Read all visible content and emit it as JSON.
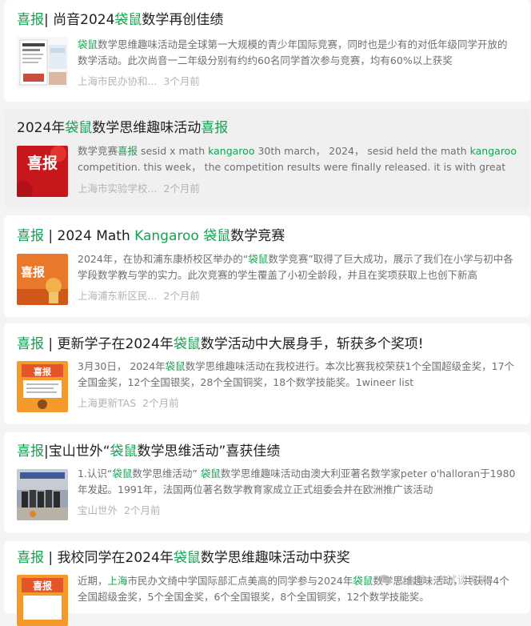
{
  "colors": {
    "keyword": "#15a150",
    "title": "#1f1f1f",
    "summary": "#6f6f6f",
    "meta": "#b3b3b3"
  },
  "articles": [
    {
      "title": [
        "喜报",
        "| 尚音2024",
        "袋鼠",
        "数学再创佳绩"
      ],
      "summary": [
        "袋鼠",
        "数学思维趣味活动是全球第一大规模的青少年国际竞赛，同时也是少有的对低年级同学开放的数学活动。此次尚音一二年级分别有约约60名同学首次参与竞赛，均有60%以上获奖"
      ],
      "source": "上海市民办协和...",
      "time": "3个月前",
      "thumb_icon": "math-kangaroo-poster-thumbnail"
    },
    {
      "title": [
        "2024年",
        "袋鼠",
        "数学思维趣味活动",
        "喜报"
      ],
      "summary": [
        "数学竞赛",
        "喜报",
        " sesid x math ",
        "kangaroo",
        " 30th march， 2024， sesid held the math ",
        "kangaroo",
        " competition. this week， the competition results were finally released. it is with great pride"
      ],
      "source": "上海市实验学校...",
      "time": "2个月前",
      "thumb_icon": "red-xibao-thumbnail",
      "thumb_text": "喜报"
    },
    {
      "title": [
        "喜报",
        " | 2024 Math ",
        "Kangaroo 袋鼠",
        "数学竞赛"
      ],
      "summary": [
        "2024年，在协和浦东康桥校区举办的“",
        "袋鼠",
        "数学竞赛”取得了巨大成功，展示了我们在小学与初中各学段数学教与学的实力。此次竞赛的学生覆盖了小初全龄段，并且在奖项获取上也创下新高"
      ],
      "source": "上海浦东新区民...",
      "time": "2个月前",
      "thumb_icon": "orange-xibao-thumbnail",
      "thumb_text": "喜报"
    },
    {
      "title": [
        "喜报",
        " | 更新学子在2024年",
        "袋鼠",
        "数学活动中大展身手，斩获多个奖项!"
      ],
      "summary": [
        "3月30日， 2024年",
        "袋鼠",
        "数学思维趣味活动在我校进行。本次比赛我校荣获1个全国超级金奖，17个全国金奖，12个全国银奖，28个全国铜奖，18个数学技能奖。1wineer list"
      ],
      "source": "上海更新TAS",
      "time": "2个月前",
      "thumb_icon": "award-poster-thumbnail",
      "thumb_text": "喜报"
    },
    {
      "title": [
        "喜报",
        "|宝山世外“",
        "袋鼠",
        "数学思维活动”喜获佳绩"
      ],
      "summary": [
        "1.认识“",
        "袋鼠",
        "数学思维活动” ",
        "袋鼠",
        "数学思维趣味活动由澳大利亚著名数学家peter o'halloran于1980年发起。1991年，法国两位著名数学教育家成立正式组委会并在欧洲推广该活动"
      ],
      "source": "宝山世外",
      "time": "2个月前",
      "thumb_icon": "group-photo-thumbnail"
    },
    {
      "title": [
        "喜报",
        " | 我校同学在2024年",
        "袋鼠",
        "数学思维趣味活动中获奖"
      ],
      "summary": [
        "近期，",
        "上海",
        "市民办文绮中学国际部汇点美高的同学参与2024年",
        "袋鼠",
        "数学思维趣味活动，共获得4个全国超级金奖，5个全国金奖，6个全国银奖，8个全国铜奖，12个数学技能奖。"
      ],
      "source": "",
      "time": "",
      "thumb_icon": "award-poster-thumbnail",
      "thumb_text": "喜报"
    }
  ],
  "watermark": {
    "text": "公众号 · 考试谈天录",
    "icon": "wechat-icon"
  }
}
